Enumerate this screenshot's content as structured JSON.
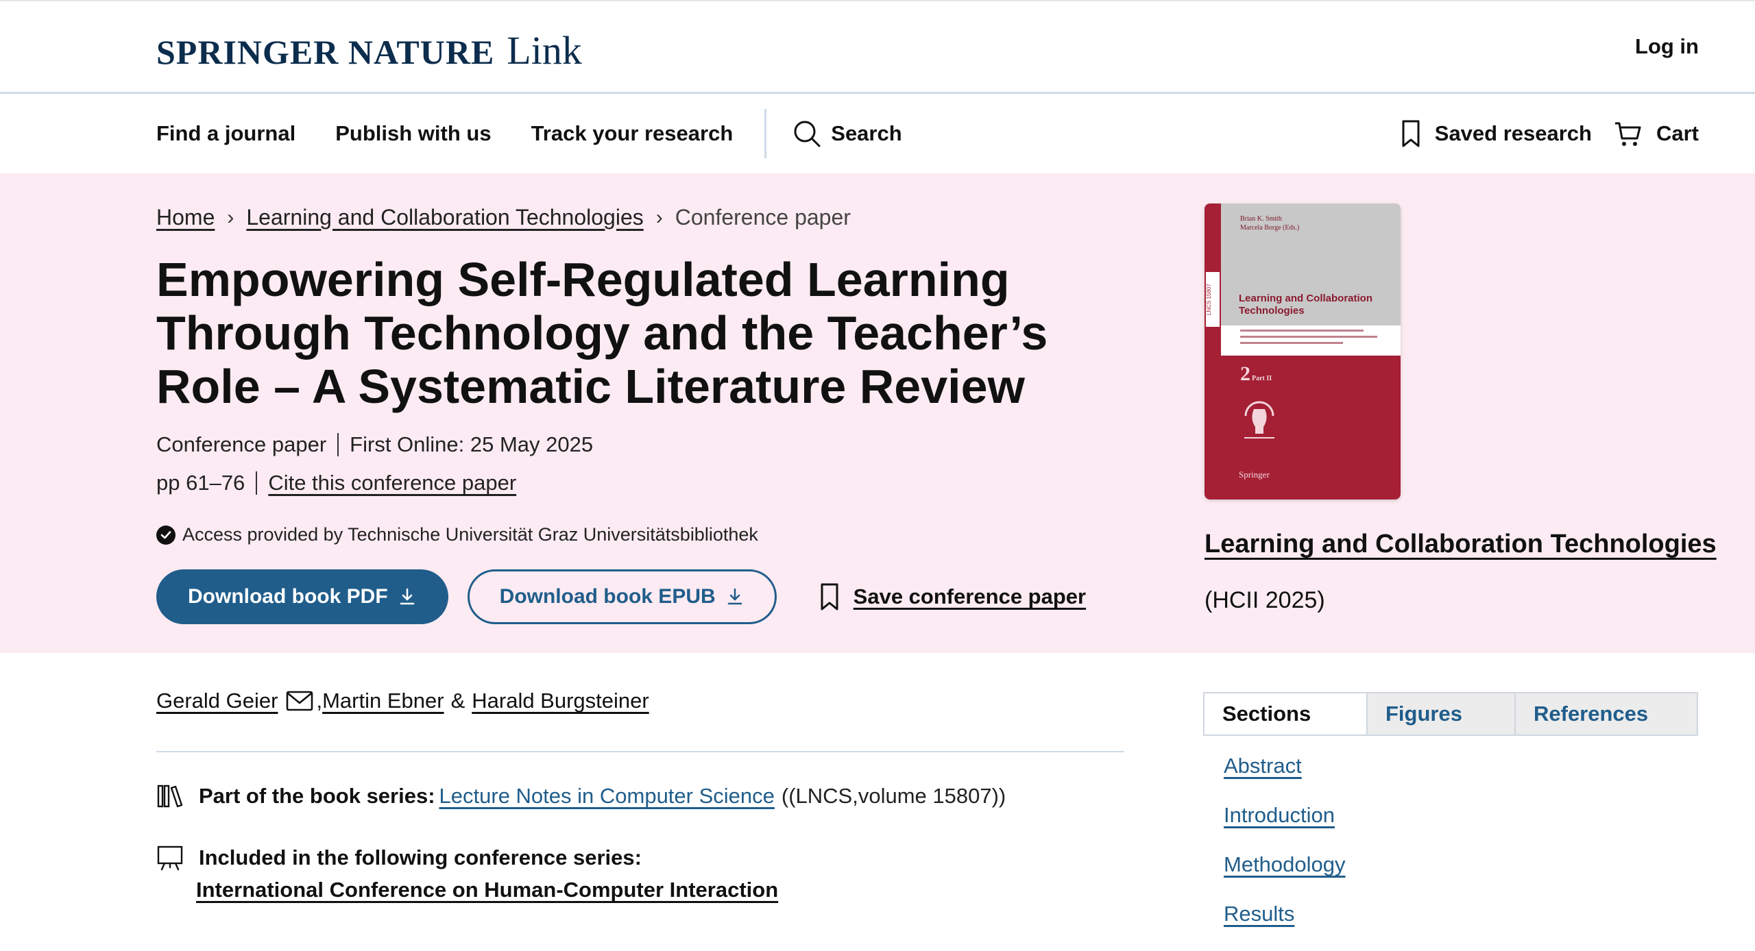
{
  "header": {
    "brand": "SPRINGER NATURE",
    "brand_suffix": "Link",
    "login_label": "Log in"
  },
  "nav": {
    "items": [
      {
        "label": "Find a journal"
      },
      {
        "label": "Publish with us"
      },
      {
        "label": "Track your research"
      }
    ],
    "search_label": "Search",
    "saved_research_label": "Saved research",
    "cart_label": "Cart"
  },
  "breadcrumb": {
    "home": "Home",
    "book": "Learning and Collaboration Technologies",
    "current": "Conference paper",
    "separator": "›"
  },
  "paper": {
    "title": "Empowering Self-Regulated Learning Through Technology and the Teacher’s Role – A Systematic Literature Review",
    "type": "Conference paper",
    "first_online": "First Online: 25 May 2025",
    "pages": "pp 61–76",
    "cite_label": "Cite this conference paper",
    "access_text": "Access provided by Technische Universität Graz Universitätsbibliothek"
  },
  "actions": {
    "download_pdf": "Download book PDF",
    "download_epub": "Download book EPUB",
    "save": "Save conference paper"
  },
  "book": {
    "title": "Learning and Collaboration Technologies",
    "subtitle": "(HCII 2025)",
    "cover": {
      "editors_line1": "Brian K. Smith",
      "editors_line2": "Marcela Borge (Eds.)",
      "title_line1": "Learning and Collaboration",
      "title_line2": "Technologies",
      "part": "2",
      "part_label": "Part II",
      "publisher": "Springer",
      "series_code": "LNCS 15807",
      "colors": {
        "accent": "#a51f35",
        "top": "#c8c8c8"
      }
    }
  },
  "authors": {
    "a1": "Gerald Geier",
    "a2": "Martin Ebner",
    "a3": "Harald Burgsteiner",
    "comma": ",",
    "amp": "&"
  },
  "series": {
    "label": "Part of the book series:",
    "link": "Lecture Notes in Computer Science",
    "tail": "((LNCS,volume 15807))"
  },
  "conference": {
    "label": "Included in the following conference series:",
    "link": "International Conference on Human-Computer Interaction"
  },
  "sidebar": {
    "tabs": [
      {
        "label": "Sections"
      },
      {
        "label": "Figures"
      },
      {
        "label": "References"
      }
    ],
    "sections": [
      {
        "label": "Abstract"
      },
      {
        "label": "Introduction"
      },
      {
        "label": "Methodology"
      },
      {
        "label": "Results"
      }
    ]
  },
  "colors": {
    "brand_blue": "#205d8b",
    "hero_bg": "#fcebf2",
    "logo_navy": "#0c2d4d"
  },
  "icons": {
    "search": "search-icon",
    "bookmark": "bookmark-icon",
    "cart": "cart-icon",
    "download": "download-icon",
    "check": "check-circle-icon",
    "mail": "mail-icon",
    "books": "books-icon",
    "presentation": "presentation-icon"
  }
}
